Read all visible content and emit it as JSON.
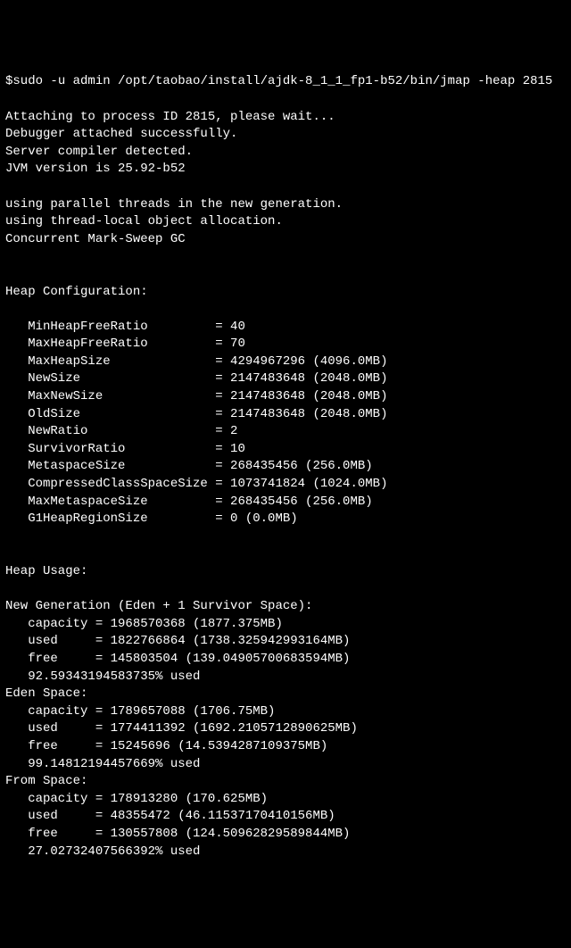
{
  "prompt": {
    "symbol": "$",
    "command": "sudo -u admin /opt/taobao/install/ajdk-8_1_1_fp1-b52/bin/jmap -heap 2815"
  },
  "preamble": [
    "Attaching to process ID 2815, please wait...",
    "Debugger attached successfully.",
    "Server compiler detected.",
    "JVM version is 25.92-b52",
    "",
    "using parallel threads in the new generation.",
    "using thread-local object allocation.",
    "Concurrent Mark-Sweep GC",
    ""
  ],
  "heapConfig": {
    "title": "Heap Configuration:",
    "lines": [
      "   MinHeapFreeRatio         = 40",
      "   MaxHeapFreeRatio         = 70",
      "   MaxHeapSize              = 4294967296 (4096.0MB)",
      "   NewSize                  = 2147483648 (2048.0MB)",
      "   MaxNewSize               = 2147483648 (2048.0MB)",
      "   OldSize                  = 2147483648 (2048.0MB)",
      "   NewRatio                 = 2",
      "   SurvivorRatio            = 10",
      "   MetaspaceSize            = 268435456 (256.0MB)",
      "   CompressedClassSpaceSize = 1073741824 (1024.0MB)",
      "   MaxMetaspaceSize         = 268435456 (256.0MB)",
      "   G1HeapRegionSize         = 0 (0.0MB)",
      ""
    ]
  },
  "heapUsage": {
    "title": "Heap Usage:",
    "sections": [
      {
        "name": "New Generation (Eden + 1 Survivor Space):",
        "lines": [
          "   capacity = 1968570368 (1877.375MB)",
          "   used     = 1822766864 (1738.325942993164MB)",
          "   free     = 145803504 (139.04905700683594MB)",
          "   92.59343194583735% used"
        ]
      },
      {
        "name": "Eden Space:",
        "lines": [
          "   capacity = 1789657088 (1706.75MB)",
          "   used     = 1774411392 (1692.2105712890625MB)",
          "   free     = 15245696 (14.5394287109375MB)",
          "   99.14812194457669% used"
        ]
      },
      {
        "name": "From Space:",
        "lines": [
          "   capacity = 178913280 (170.625MB)",
          "   used     = 48355472 (46.11537170410156MB)",
          "   free     = 130557808 (124.50962829589844MB)",
          "   27.02732407566392% used"
        ]
      }
    ]
  }
}
